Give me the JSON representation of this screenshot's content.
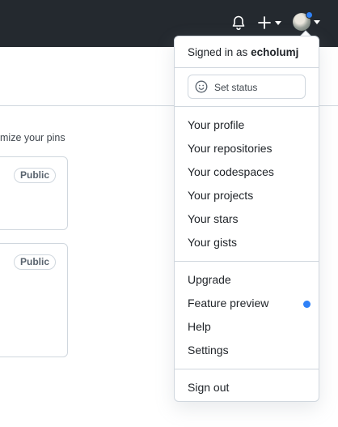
{
  "header": {
    "icons": [
      "bell-icon",
      "plus-icon",
      "avatar"
    ],
    "accent": "#2f81f7",
    "background": "#24292f"
  },
  "background_page": {
    "customize_text": "mize your pins",
    "cards": [
      {
        "visibility": "Public"
      },
      {
        "visibility": "Public"
      }
    ]
  },
  "menu": {
    "signed_in_prefix": "Signed in as",
    "username": "echolumj",
    "set_status": "Set status",
    "group1": [
      "Your profile",
      "Your repositories",
      "Your codespaces",
      "Your projects",
      "Your stars",
      "Your gists"
    ],
    "group2": [
      "Upgrade",
      "Feature preview",
      "Help",
      "Settings"
    ],
    "sign_out": "Sign out"
  }
}
